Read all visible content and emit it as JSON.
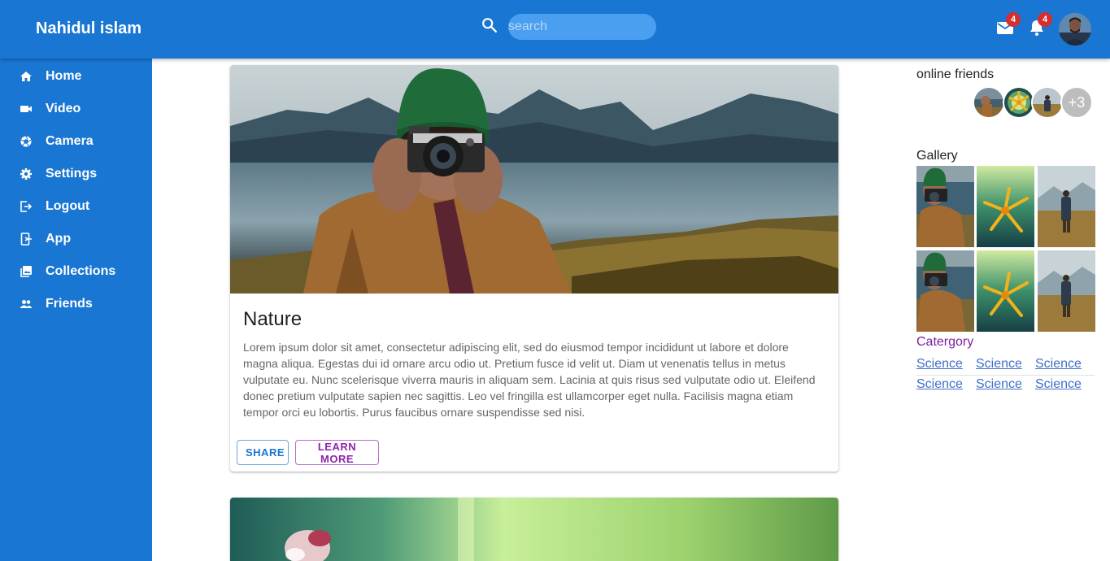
{
  "header": {
    "brand": "Nahidul islam",
    "search_placeholder": "search",
    "mail_count": "4",
    "notification_count": "4",
    "bg_color": "#1976d2"
  },
  "sidebar": {
    "items": [
      {
        "label": "Home",
        "icon": "home-icon"
      },
      {
        "label": "Video",
        "icon": "video-icon"
      },
      {
        "label": "Camera",
        "icon": "camera-icon"
      },
      {
        "label": "Settings",
        "icon": "gear-icon"
      },
      {
        "label": "Logout",
        "icon": "logout-icon"
      },
      {
        "label": "App",
        "icon": "app-icon"
      },
      {
        "label": "Collections",
        "icon": "collections-icon"
      },
      {
        "label": "Friends",
        "icon": "people-icon"
      }
    ]
  },
  "feed": {
    "posts": [
      {
        "title": "Nature",
        "body": "Lorem ipsum dolor sit amet, consectetur adipiscing elit, sed do eiusmod tempor incididunt ut labore et dolore magna aliqua. Egestas dui id ornare arcu odio ut. Pretium fusce id velit ut. Diam ut venenatis tellus in metus vulputate eu. Nunc scelerisque viverra mauris in aliquam sem. Lacinia at quis risus sed vulputate odio ut. Eleifend donec pretium vulputate sapien nec sagittis. Leo vel fringilla est ullamcorper eget nulla. Facilisis magna etiam tempor orci eu lobortis. Purus faucibus ornare suspendisse sed nisi.",
        "share_label": "SHARE",
        "learn_label": "LEARN MORE"
      }
    ]
  },
  "right": {
    "online_heading": "online friends",
    "more_friends": "+3",
    "gallery_heading": "Gallery",
    "category_heading": "Catergory",
    "categories": [
      "Science",
      "Science",
      "Science",
      "Science",
      "Science",
      "Science"
    ]
  }
}
